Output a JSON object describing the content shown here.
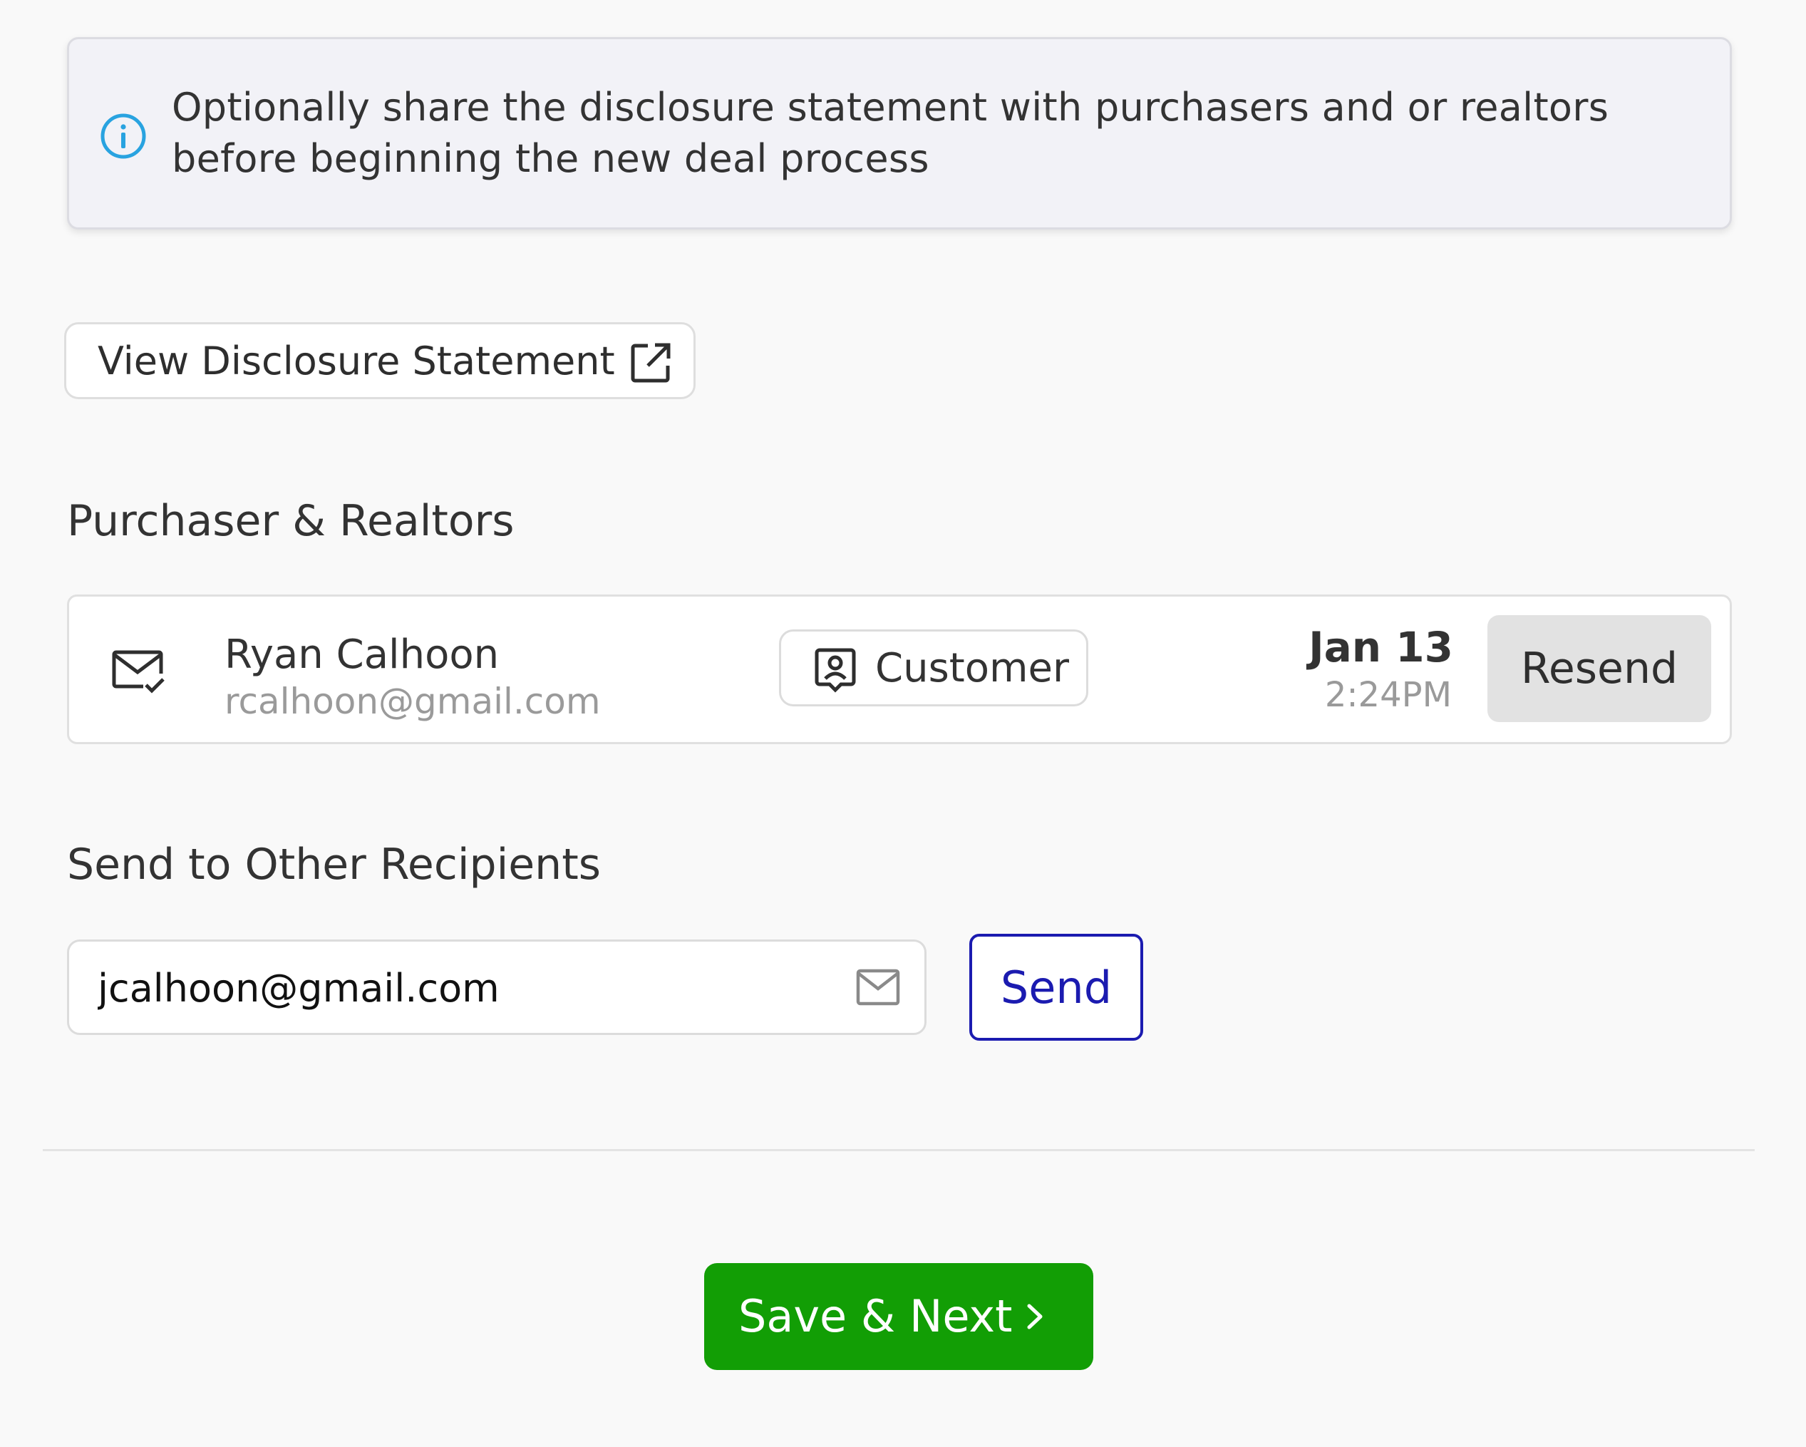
{
  "info_banner": {
    "icon": "info-icon",
    "text": "Optionally share the disclosure statement with purchasers and or realtors before beginning the new deal process"
  },
  "view_disclosure": {
    "label": "View Disclosure Statement",
    "icon": "external-link-icon"
  },
  "purchasers": {
    "heading": "Purchaser & Realtors",
    "recipients": [
      {
        "status_icon": "mail-check-icon",
        "name": "Ryan Calhoon",
        "email": "rcalhoon@gmail.com",
        "role_icon": "contact-icon",
        "role": "Customer",
        "date": "Jan 13",
        "time": "2:24PM",
        "action": "Resend"
      }
    ]
  },
  "other_recipients": {
    "heading": "Send to Other Recipients",
    "email_value": "jcalhoon@gmail.com",
    "input_icon": "envelope-icon",
    "send_label": "Send"
  },
  "footer": {
    "save_next_label": "Save & Next",
    "icon": "chevron-right-icon"
  },
  "colors": {
    "info_icon": "#29a3e0",
    "send_accent": "#1b1bb0",
    "primary_green": "#129e05",
    "resend_bg": "#e2e2e2"
  }
}
